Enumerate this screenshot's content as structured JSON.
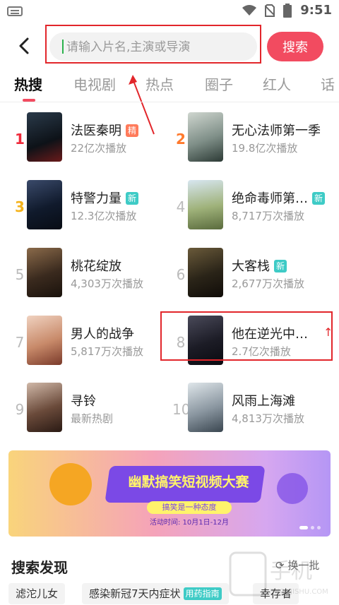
{
  "status_bar": {
    "time": "9:51"
  },
  "search": {
    "placeholder": "请输入片名,主演或导演",
    "button_label": "搜索"
  },
  "tabs": [
    {
      "label": "热搜"
    },
    {
      "label": "电视剧"
    },
    {
      "label": "热点"
    },
    {
      "label": "圈子"
    },
    {
      "label": "红人"
    },
    {
      "label": "话"
    }
  ],
  "hot_list": [
    {
      "rank": "1",
      "title": "法医秦明",
      "badge": "精",
      "plays": "22亿次播放"
    },
    {
      "rank": "2",
      "title": "无心法师第一季",
      "badge": "",
      "plays": "19.8亿次播放"
    },
    {
      "rank": "3",
      "title": "特警力量",
      "badge": "新",
      "plays": "12.3亿次播放"
    },
    {
      "rank": "4",
      "title": "绝命毒师第…",
      "badge": "新",
      "plays": "8,717万次播放"
    },
    {
      "rank": "5",
      "title": "桃花绽放",
      "badge": "",
      "plays": "4,303万次播放"
    },
    {
      "rank": "6",
      "title": "大客栈",
      "badge": "新",
      "plays": "2,677万次播放"
    },
    {
      "rank": "7",
      "title": "男人的战争",
      "badge": "",
      "plays": "5,817万次播放"
    },
    {
      "rank": "8",
      "title": "他在逆光中…",
      "badge": "",
      "plays": "2.7亿次播放"
    },
    {
      "rank": "9",
      "title": "寻铃",
      "badge": "",
      "plays": "最新热剧"
    },
    {
      "rank": "10",
      "title": "风雨上海滩",
      "badge": "",
      "plays": "4,813万次播放"
    }
  ],
  "banner": {
    "title": "幽默搞笑短视频大赛",
    "subtitle": "搞笑是一种态度",
    "date": "活动时间: 10月1日-12月"
  },
  "discover": {
    "title": "搜索发现",
    "refresh_label": "换一批",
    "chips": [
      {
        "label": "滤沱儿女",
        "tag": ""
      },
      {
        "label": "感染新冠7天内症状",
        "tag": "用药指南"
      },
      {
        "label": "幸存者",
        "tag": ""
      }
    ]
  },
  "watermark": {
    "text": "SHOUJISHU.COM"
  },
  "colors": {
    "accent": "#f24b60",
    "annotation": "#e2262b",
    "new_badge": "#3ecbc6",
    "jing_badge": "#ff7a5a"
  }
}
